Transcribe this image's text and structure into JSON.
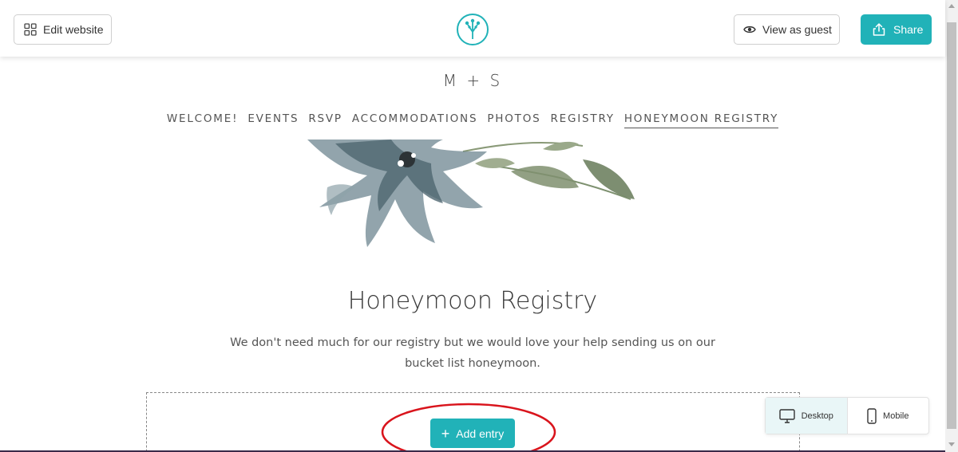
{
  "toolbar": {
    "edit_label": "Edit website",
    "guest_label": "View as guest",
    "share_label": "Share",
    "accent_color": "#21b2b8"
  },
  "site": {
    "monogram": "M + S",
    "nav": [
      "WELCOME!",
      "EVENTS",
      "RSVP",
      "ACCOMMODATIONS",
      "PHOTOS",
      "REGISTRY",
      "HONEYMOON REGISTRY"
    ],
    "active_nav": "HONEYMOON REGISTRY",
    "heading": "Honeymoon Registry",
    "description": "We don't need much for our registry but we would love your help sending us on our bucket list honeymoon.",
    "add_entry_label": "Add entry"
  },
  "device_toggle": {
    "desktop_label": "Desktop",
    "mobile_label": "Mobile",
    "selected": "Desktop"
  },
  "icons": [
    "grid-icon",
    "logo-icon",
    "eye-icon",
    "share-icon",
    "plus-icon",
    "desktop-icon",
    "mobile-icon"
  ],
  "annotation_color": "#d9141c"
}
